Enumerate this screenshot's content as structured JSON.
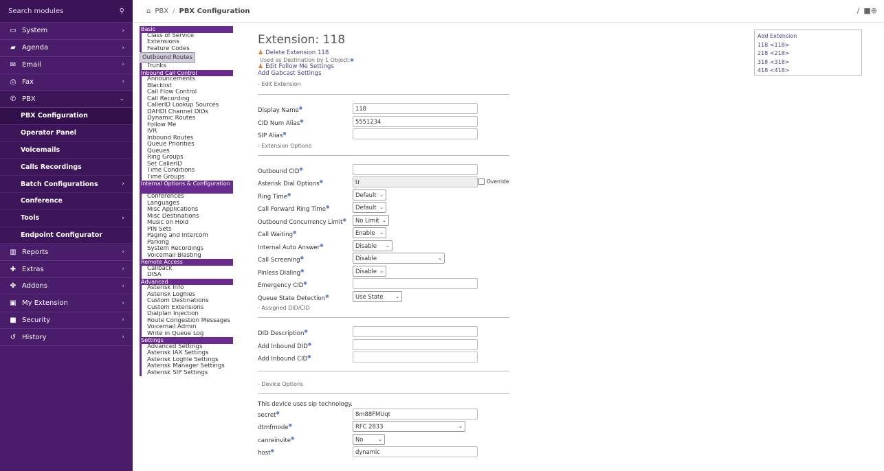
{
  "sidebar": {
    "search": "Search modules",
    "search_icon": "search-icon",
    "items": [
      {
        "label": "System",
        "icon": "monitor-icon",
        "chev": "›"
      },
      {
        "label": "Agenda",
        "icon": "book-icon",
        "chev": "›"
      },
      {
        "label": "Email",
        "icon": "envelope-icon",
        "chev": "›"
      },
      {
        "label": "Fax",
        "icon": "printer-icon",
        "chev": "›"
      },
      {
        "label": "PBX",
        "icon": "phone-icon",
        "chev": "⌄"
      }
    ],
    "pbx_sub": [
      {
        "label": "PBX Configuration",
        "chev": ""
      },
      {
        "label": "Operator Panel",
        "chev": ""
      },
      {
        "label": "Voicemails",
        "chev": ""
      },
      {
        "label": "Calls Recordings",
        "chev": ""
      },
      {
        "label": "Batch Configurations",
        "chev": "›"
      },
      {
        "label": "Conference",
        "chev": ""
      },
      {
        "label": "Tools",
        "chev": "›"
      },
      {
        "label": "Endpoint Configurator",
        "chev": ""
      }
    ],
    "items2": [
      {
        "label": "Reports",
        "icon": "chart-icon",
        "chev": "›"
      },
      {
        "label": "Extras",
        "icon": "plus-icon",
        "chev": "›"
      },
      {
        "label": "Addons",
        "icon": "puzzle-icon",
        "chev": "›"
      },
      {
        "label": "My Extension",
        "icon": "briefcase-icon",
        "chev": "›"
      },
      {
        "label": "Security",
        "icon": "lock-icon",
        "chev": "›"
      },
      {
        "label": "History",
        "icon": "history-icon",
        "chev": "›"
      }
    ]
  },
  "topbar": {
    "home_icon": "home-icon",
    "crumb1": "PBX",
    "sep": "/",
    "crumb2": "PBX Configuration",
    "right_sep": "/",
    "right_icons": "■⊕"
  },
  "modules": [
    {
      "h": "Basic"
    },
    {
      "i": "Class of Service"
    },
    {
      "i": "Extensions"
    },
    {
      "i": "Feature Codes"
    },
    {
      "i": "Outbound Routes",
      "sel": true
    },
    {
      "i": "Trunks"
    },
    {
      "h": "Inbound Call Control"
    },
    {
      "i": "Announcements"
    },
    {
      "i": "Blacklist"
    },
    {
      "i": "Call Flow Control"
    },
    {
      "i": "Call Recording"
    },
    {
      "i": "CallerID Lookup Sources"
    },
    {
      "i": "DAHDI Channel DIDs"
    },
    {
      "i": "Dynamic Routes"
    },
    {
      "i": "Follow Me"
    },
    {
      "i": "IVR"
    },
    {
      "i": "Inbound Routes"
    },
    {
      "i": "Queue Priorities"
    },
    {
      "i": "Queues"
    },
    {
      "i": "Ring Groups"
    },
    {
      "i": "Set CallerID"
    },
    {
      "i": "Time Conditions"
    },
    {
      "i": "Time Groups"
    },
    {
      "h": "Internal Options & Configuration",
      "two": true
    },
    {
      "i": "Conferences"
    },
    {
      "i": "Languages"
    },
    {
      "i": "Misc Applications"
    },
    {
      "i": "Misc Destinations"
    },
    {
      "i": "Music on Hold"
    },
    {
      "i": "PIN Sets"
    },
    {
      "i": "Paging and Intercom"
    },
    {
      "i": "Parking"
    },
    {
      "i": "System Recordings"
    },
    {
      "i": "Voicemail Blasting"
    },
    {
      "h": "Remote Access"
    },
    {
      "i": "Callback"
    },
    {
      "i": "DISA"
    },
    {
      "h": "Advanced"
    },
    {
      "i": "Asterisk Info"
    },
    {
      "i": "Asterisk Logfiles"
    },
    {
      "i": "Custom Destinations"
    },
    {
      "i": "Custom Extensions"
    },
    {
      "i": "Dialplan Injection"
    },
    {
      "i": "Route Congestion Messages"
    },
    {
      "i": "Voicemail Admin"
    },
    {
      "i": "Write in Queue Log"
    },
    {
      "h": "Settings"
    },
    {
      "i": "Advanced Settings"
    },
    {
      "i": "Asterisk IAX Settings"
    },
    {
      "i": "Asterisk Logfile Settings"
    },
    {
      "i": "Asterisk Manager Settings"
    },
    {
      "i": "Asterisk SIP Settings"
    }
  ],
  "main": {
    "title": "Extension: 118",
    "delete": "Delete Extension 118",
    "used": "Used as Destination by 1 Object:",
    "follow": "Edit Follow Me Settings",
    "gabcast": "Add Gabcast Settings",
    "edit_ext": "- Edit Extension",
    "display_name": {
      "label": "Display Name",
      "value": "118"
    },
    "cid_alias": {
      "label": "CID Num Alias",
      "value": "5551234"
    },
    "sip_alias": {
      "label": "SIP Alias",
      "value": ""
    },
    "ext_opts": "- Extension Options",
    "outbound_cid": {
      "label": "Outbound CID",
      "value": ""
    },
    "dial_opts": {
      "label": "Asterisk Dial Options",
      "value": "tr",
      "override": "Override"
    },
    "ring_time": {
      "label": "Ring Time",
      "value": "Default"
    },
    "cf_ring": {
      "label": "Call Forward Ring Time",
      "value": "Default"
    },
    "conc": {
      "label": "Outbound Concurrency Limit",
      "value": "No Limit"
    },
    "waiting": {
      "label": "Call Waiting",
      "value": "Enable"
    },
    "auto_ans": {
      "label": "Internal Auto Answer",
      "value": "Disable"
    },
    "screening": {
      "label": "Call Screening",
      "value": "Disable"
    },
    "pinless": {
      "label": "Pinless Dialing",
      "value": "Disable"
    },
    "emerg": {
      "label": "Emergency CID",
      "value": ""
    },
    "qstate": {
      "label": "Queue State Detection",
      "value": "Use State"
    },
    "assigned": "- Assigned DID/CID",
    "did_desc": {
      "label": "DID Description",
      "value": ""
    },
    "did_add": {
      "label": "Add Inbound DID",
      "value": ""
    },
    "cid_add": {
      "label": "Add Inbound CID",
      "value": ""
    },
    "dev_opts": "- Device Options",
    "sip_note": "This device uses sip technology.",
    "secret": {
      "label": "secret",
      "value": "8m88FMUqt"
    },
    "dtmf": {
      "label": "dtmfmode",
      "value": "RFC 2833"
    },
    "canrein": {
      "label": "canreinvite",
      "value": "No"
    },
    "host": {
      "label": "host",
      "value": "dynamic"
    }
  },
  "extlist": {
    "title": "Add Extension",
    "items": [
      "118 <118>",
      "218 <218>",
      "318 <318>",
      "418 <418>"
    ]
  }
}
